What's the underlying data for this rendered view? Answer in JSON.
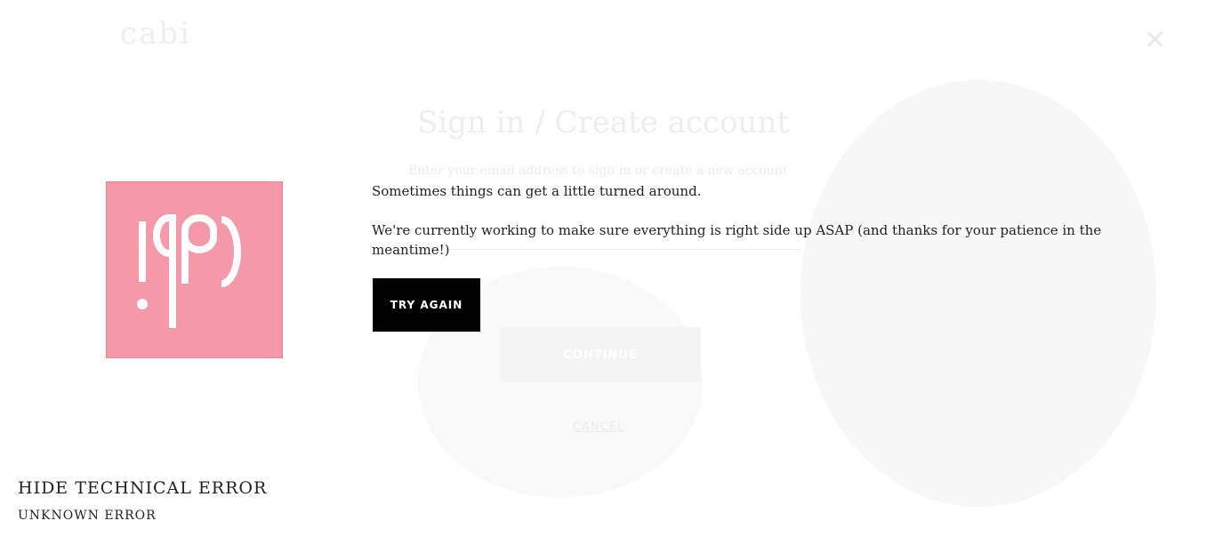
{
  "background": {
    "logo_text": "cabi",
    "title": "Sign in / Create account",
    "subtitle": "Enter your email address to sign in or create a new account",
    "continue_label": "CONTINUE",
    "cancel_label": "CANCEL",
    "close_icon": "close-icon"
  },
  "error": {
    "logo_icon": "cabi-logo",
    "logo_color": "#f598a8",
    "message_1": "Sometimes things can get a little turned around.",
    "message_2": "We're currently working to make sure everything is right side up ASAP (and thanks for your patience in the meantime!)",
    "try_again_label": "TRY AGAIN",
    "toggle_label": "HIDE TECHNICAL ERROR",
    "technical_detail": "UNKNOWN ERROR"
  }
}
